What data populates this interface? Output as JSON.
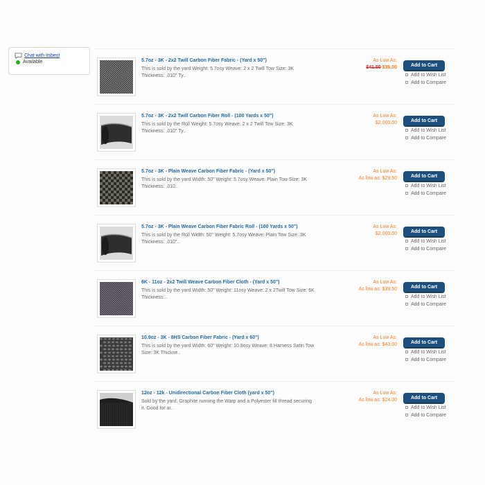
{
  "chat": {
    "link_label": "Chat with itsbest",
    "status": "Available",
    "status_color": "#22b122"
  },
  "colors": {
    "title_link": "#1f6aa5",
    "as_low_as": "#ff7a1a",
    "old_price": "#e0262b",
    "cart_button": "#1d4f7d"
  },
  "products": [
    {
      "title": "5.7oz - 3K - 2x2 Twill Carbon Fiber Fabric - (Yard x 50\")",
      "desc": "This is sold by the yard Weight: 5.7osy Weave: 2 x 2 Twill Tow Size: 3K Thickness: .010\" Ty..",
      "as_low_as": "As Low As:",
      "price_line": "",
      "old_price": "$41.50",
      "new_price": "$36.00",
      "cart_label": "Add to Cart",
      "wishlist_label": "Add to Wish List",
      "compare_label": "Add to Compare",
      "thumb_icon": "twill-weave-fabric"
    },
    {
      "title": "5.7oz - 3K - 2x2 Twill Carbon Fiber Roll - (100 Yards x 50\")",
      "desc": "This is sold by the Roll Weight: 5.7osy Weave: 2 x 2 Twill Tow Size: 3K Thickness: .010\" Ty..",
      "as_low_as": "As Low As:",
      "price_line": "$2,000.00",
      "old_price": "",
      "new_price": "",
      "cart_label": "Add to Cart",
      "wishlist_label": "Add to Wish List",
      "compare_label": "Add to Compare",
      "thumb_icon": "fabric-roll"
    },
    {
      "title": "5.7oz - 3K - Plain Weave Carbon Fiber Fabric - (Yard x 50\")",
      "desc": "This is sold by the yard Width: 50\" Weight: 5.7osy Weave: Plain Tow Size: 3K Thickness: .010..",
      "as_low_as": "As Low As:",
      "price_line": "As low as: $29.50",
      "old_price": "",
      "new_price": "",
      "cart_label": "Add to Cart",
      "wishlist_label": "Add to Wish List",
      "compare_label": "Add to Compare",
      "thumb_icon": "plain-weave-fabric"
    },
    {
      "title": "5.7oz - 3K - Plain Weave Carbon Fiber Fabric Roll - (100 Yards x 50\")",
      "desc": "This is sold by the Roll Width: 50\" Weight: 5.7osy Weave: Plain Tow Size: 3K Thickness: .010\"..",
      "as_low_as": "As Low As:",
      "price_line": "$2,000.00",
      "old_price": "",
      "new_price": "",
      "cart_label": "Add to Cart",
      "wishlist_label": "Add to Wish List",
      "compare_label": "Add to Compare",
      "thumb_icon": "fabric-roll"
    },
    {
      "title": "6K - 11oz - 2x2 Twill Weave Carbon Fiber Cloth - (Yard x 50\")",
      "desc": "This is sold by the yard Width: 50\" Weight: 11osy Weave: 2 x 2Twill Tow Size: 6K Thickness:..",
      "as_low_as": "As Low As:",
      "price_line": "As low as: $39.50",
      "old_price": "",
      "new_price": "",
      "cart_label": "Add to Cart",
      "wishlist_label": "Add to Wish List",
      "compare_label": "Add to Compare",
      "thumb_icon": "twill-weave-cloth"
    },
    {
      "title": "10.9oz - 3K - 8HS Carbon Fiber Fabric - (Yard x 60\")",
      "desc": "This is sold by the yard Width: 60\" Weight: 10.9osy Weave: 8 Harness Satin Tow Size: 3K Thickne..",
      "as_low_as": "As Low As:",
      "price_line": "As low as: $43.00",
      "old_price": "",
      "new_price": "",
      "cart_label": "Add to Cart",
      "wishlist_label": "Add to Wish List",
      "compare_label": "Add to Compare",
      "thumb_icon": "satin-weave-fabric"
    },
    {
      "title": "12oz - 12k - Unidirectional Carbon Fiber Cloth (yard x 50\")",
      "desc": "Sold by the yard. Graphite running the Warp and a Polyester fill thread securing it. Good for ar..",
      "as_low_as": "As Low As:",
      "price_line": "As low as: $24.00",
      "old_price": "",
      "new_price": "",
      "cart_label": "Add to Cart",
      "wishlist_label": "Add to Wish List",
      "compare_label": "Add to Compare",
      "thumb_icon": "unidirectional-cloth"
    }
  ]
}
